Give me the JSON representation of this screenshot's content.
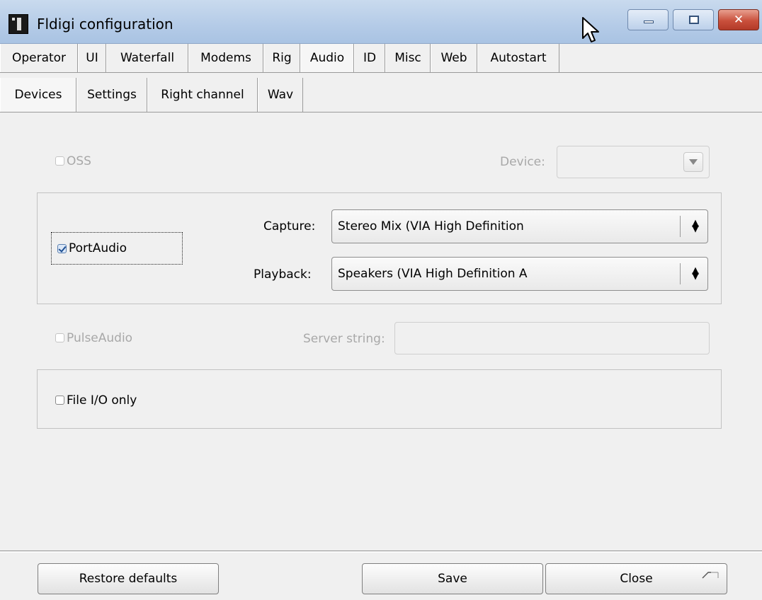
{
  "window": {
    "title": "Fldigi configuration"
  },
  "tabs_main": [
    {
      "label": "Operator"
    },
    {
      "label": "UI"
    },
    {
      "label": "Waterfall"
    },
    {
      "label": "Modems"
    },
    {
      "label": "Rig"
    },
    {
      "label": "Audio",
      "active": true
    },
    {
      "label": "ID"
    },
    {
      "label": "Misc"
    },
    {
      "label": "Web"
    },
    {
      "label": "Autostart"
    }
  ],
  "tabs_sub": [
    {
      "label": "Devices",
      "active": true
    },
    {
      "label": "Settings"
    },
    {
      "label": "Right channel"
    },
    {
      "label": "Wav"
    }
  ],
  "devices": {
    "oss": {
      "label": "OSS",
      "checked": false,
      "enabled": false
    },
    "oss_device": {
      "label": "Device:",
      "value": ""
    },
    "portaudio": {
      "label": "PortAudio",
      "checked": true
    },
    "capture": {
      "label": "Capture:",
      "value": "Stereo Mix (VIA High Definition"
    },
    "playback": {
      "label": "Playback:",
      "value": "Speakers (VIA High Definition A"
    },
    "pulseaudio": {
      "label": "PulseAudio",
      "checked": false,
      "enabled": false
    },
    "server_string": {
      "label": "Server string:",
      "value": ""
    },
    "file_io": {
      "label": "File I/O only",
      "checked": false
    }
  },
  "buttons": {
    "restore": "Restore defaults",
    "save": "Save",
    "close": "Close"
  }
}
